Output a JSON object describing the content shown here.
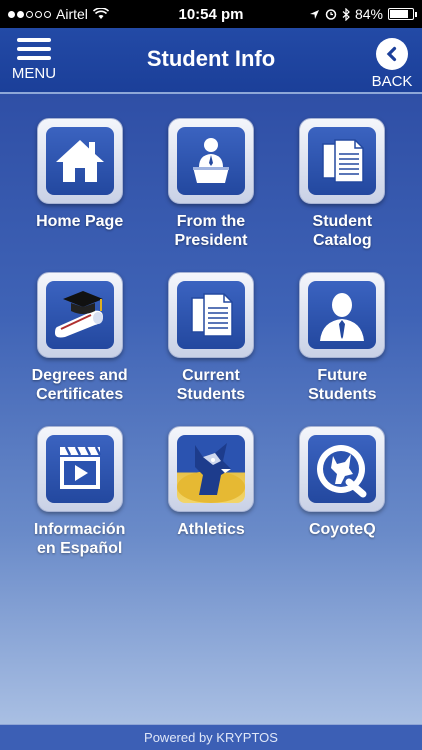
{
  "status_bar": {
    "carrier": "Airtel",
    "time": "10:54 pm",
    "battery": "84%",
    "battery_level": 0.84,
    "signal_strength": 2,
    "signal_max": 5
  },
  "header": {
    "title": "Student Info",
    "menu_label": "MENU",
    "back_label": "BACK"
  },
  "tiles": [
    {
      "label": "Home Page",
      "icon": "house-icon"
    },
    {
      "label": "From the\nPresident",
      "icon": "president-podium-icon"
    },
    {
      "label": "Student\nCatalog",
      "icon": "document-stack-icon"
    },
    {
      "label": "Degrees and\nCertificates",
      "icon": "graduation-cap-diploma-icon"
    },
    {
      "label": "Current\nStudents",
      "icon": "document-stack-icon"
    },
    {
      "label": "Future\nStudents",
      "icon": "person-silhouette-icon"
    },
    {
      "label": "Información\nen Español",
      "icon": "video-play-icon"
    },
    {
      "label": "Athletics",
      "icon": "coyote-mascot-icon"
    },
    {
      "label": "CoyoteQ",
      "icon": "coyote-q-logo-icon"
    }
  ],
  "footer": {
    "text": "Powered by KRYPTOS"
  },
  "colors": {
    "header": "#1b3f99",
    "tile_inner": "#2b53b0",
    "footer": "#3c5fb5"
  }
}
